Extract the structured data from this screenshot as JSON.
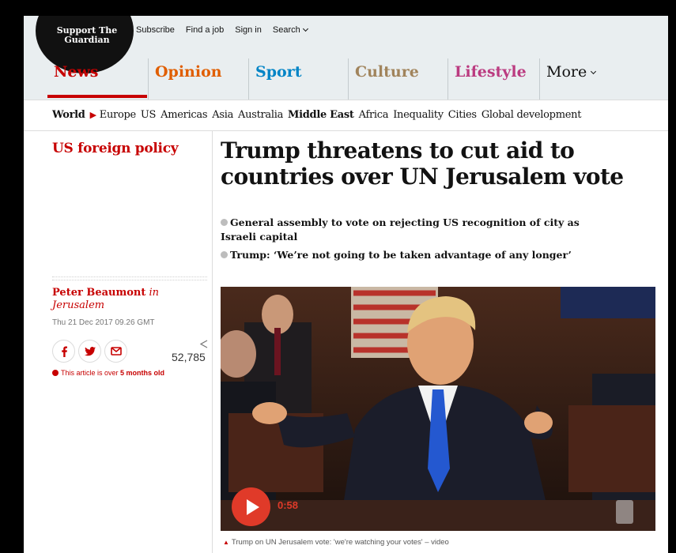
{
  "header": {
    "support": [
      "Support The",
      "Guardian"
    ],
    "top_links": [
      "Subscribe",
      "Find a job",
      "Sign in",
      "Search"
    ],
    "pillars": [
      "News",
      "Opinion",
      "Sport",
      "Culture",
      "Lifestyle",
      "More"
    ]
  },
  "subnav": {
    "section": "World",
    "items": [
      "Europe",
      "US",
      "Americas",
      "Asia",
      "Australia",
      "Middle East",
      "Africa",
      "Inequality",
      "Cities",
      "Global development"
    ],
    "bold_item": "Middle East"
  },
  "article": {
    "kicker": "US foreign policy",
    "headline": "Trump threatens to cut aid to countries over UN Jerusalem vote",
    "standfirst": [
      "General assembly to vote on rejecting US recognition of city as Israeli capital",
      "Trump: ‘We’re not going to be taken advantage of any longer’"
    ],
    "author": "Peter Beaumont",
    "author_in": "in",
    "location": "Jerusalem",
    "date": "Thu 21 Dec 2017 09.26 GMT",
    "share_count": "52,785",
    "age_notice_prefix": "This article is over ",
    "age_notice_bold": "5 months old",
    "video_time": "0:58",
    "caption": "Trump on UN Jerusalem vote: 'we're watching your votes' – video"
  },
  "colors": {
    "news": "#c70000",
    "opinion": "#e05e00",
    "sport": "#0084c6",
    "culture": "#a1845c",
    "lifestyle": "#bb3b80",
    "play": "#e03a29"
  },
  "icons": [
    "facebook-icon",
    "twitter-icon",
    "email-icon",
    "share-icon",
    "play-icon",
    "alert-icon",
    "chevron-down-icon"
  ]
}
